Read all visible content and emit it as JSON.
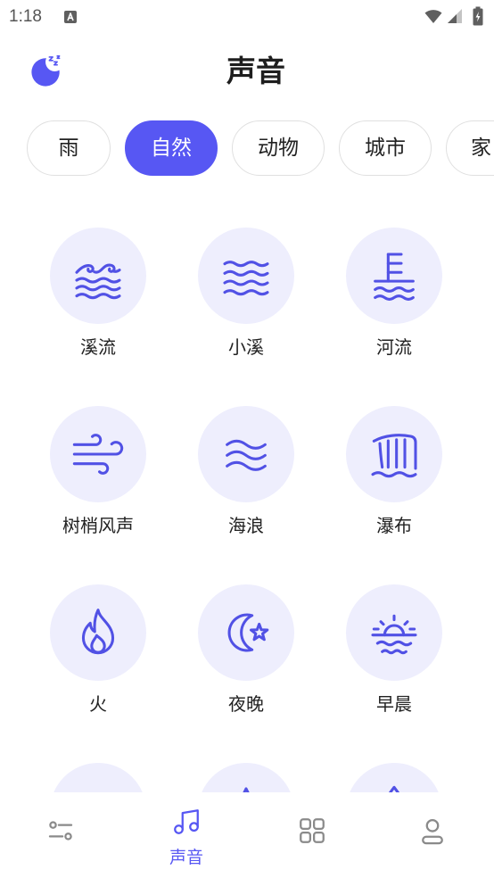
{
  "status_bar": {
    "time": "1:18",
    "icons": [
      "notification-a-icon",
      "wifi-icon",
      "cellular-signal-icon",
      "battery-charging-icon"
    ]
  },
  "header": {
    "title": "声音",
    "left_icon": "sleep-moon-icon"
  },
  "categories": [
    {
      "label": "雨",
      "selected": false
    },
    {
      "label": "自然",
      "selected": true
    },
    {
      "label": "动物",
      "selected": false
    },
    {
      "label": "城市",
      "selected": false
    },
    {
      "label": "家",
      "selected": false
    }
  ],
  "sounds": [
    {
      "label": "溪流",
      "icon": "stream-waves-icon"
    },
    {
      "label": "小溪",
      "icon": "brook-waves-icon"
    },
    {
      "label": "河流",
      "icon": "river-gauge-icon"
    },
    {
      "label": "树梢风声",
      "icon": "wind-icon"
    },
    {
      "label": "海浪",
      "icon": "ocean-waves-icon"
    },
    {
      "label": "瀑布",
      "icon": "waterfall-icon"
    },
    {
      "label": "火",
      "icon": "fire-icon"
    },
    {
      "label": "夜晚",
      "icon": "moon-star-icon"
    },
    {
      "label": "早晨",
      "icon": "sunrise-icon"
    },
    {
      "icon": "cloud-icon"
    },
    {
      "icon": "mountain-icon"
    },
    {
      "icon": "water-drop-icon"
    }
  ],
  "bottom_nav": [
    {
      "icon": "sliders-icon",
      "active": false
    },
    {
      "icon": "music-note-icon",
      "label": "声音",
      "active": true
    },
    {
      "icon": "grid-icon",
      "active": false
    },
    {
      "icon": "profile-icon",
      "active": false
    }
  ],
  "colors": {
    "accent": "#5757f3",
    "icon": "#5151e5",
    "circle_background": "#eeeefd",
    "chip_border": "#e0e0e0",
    "text": "#222222",
    "nav_inactive": "#8a8a8a"
  }
}
